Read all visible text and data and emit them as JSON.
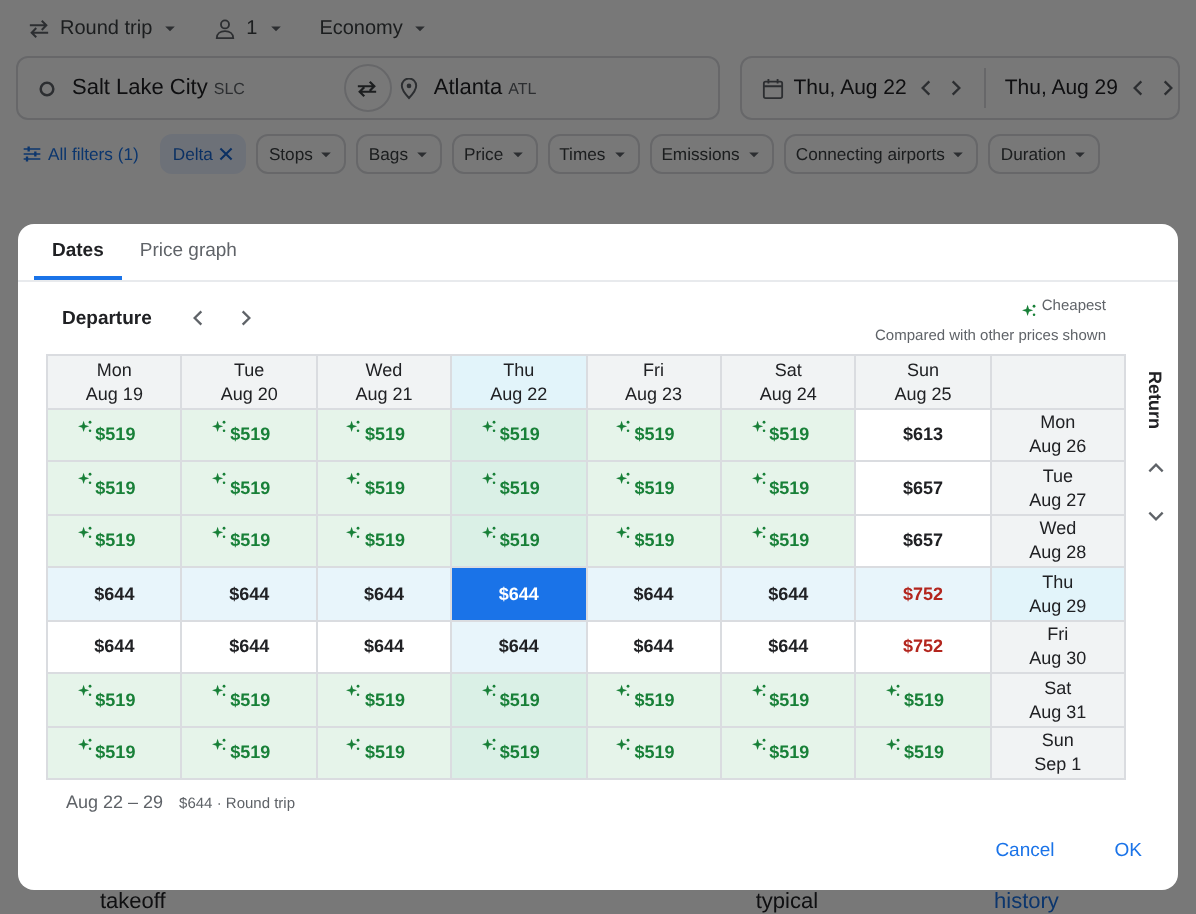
{
  "top_bar": {
    "trip_type": "Round trip",
    "passengers": "1",
    "cabin": "Economy"
  },
  "search": {
    "origin": {
      "city": "Salt Lake City",
      "code": "SLC"
    },
    "destination": {
      "city": "Atlanta",
      "code": "ATL"
    },
    "departure_date": "Thu, Aug 22",
    "return_date": "Thu, Aug 29"
  },
  "filters": [
    {
      "label": "All filters (1)",
      "kind": "all"
    },
    {
      "label": "Delta",
      "kind": "active"
    },
    {
      "label": "Stops",
      "kind": "dropdown"
    },
    {
      "label": "Bags",
      "kind": "dropdown"
    },
    {
      "label": "Price",
      "kind": "dropdown"
    },
    {
      "label": "Times",
      "kind": "dropdown"
    },
    {
      "label": "Emissions",
      "kind": "dropdown"
    },
    {
      "label": "Connecting airports",
      "kind": "dropdown"
    },
    {
      "label": "Duration",
      "kind": "dropdown"
    }
  ],
  "background_texts": [
    {
      "text": "takeoff",
      "kind": "text"
    },
    {
      "text": "typical",
      "kind": "text"
    },
    {
      "text": "history",
      "kind": "link"
    }
  ],
  "dialog": {
    "tabs": [
      {
        "label": "Dates",
        "selected": true
      },
      {
        "label": "Price graph",
        "selected": false
      }
    ],
    "departure_label": "Departure",
    "legend": "Cheapest",
    "legend_note": "Compared with other prices shown",
    "return_label": "Return",
    "columns": [
      {
        "day": "Mon",
        "date": "Aug 19",
        "selected": false
      },
      {
        "day": "Tue",
        "date": "Aug 20",
        "selected": false
      },
      {
        "day": "Wed",
        "date": "Aug 21",
        "selected": false
      },
      {
        "day": "Thu",
        "date": "Aug 22",
        "selected": true
      },
      {
        "day": "Fri",
        "date": "Aug 23",
        "selected": false
      },
      {
        "day": "Sat",
        "date": "Aug 24",
        "selected": false
      },
      {
        "day": "Sun",
        "date": "Aug 25",
        "selected": false
      }
    ],
    "rows": [
      {
        "day": "Mon",
        "date": "Aug 26",
        "selected": false,
        "cells": [
          {
            "price": "$519",
            "kind": "cheapest"
          },
          {
            "price": "$519",
            "kind": "cheapest"
          },
          {
            "price": "$519",
            "kind": "cheapest"
          },
          {
            "price": "$519",
            "kind": "cheapest"
          },
          {
            "price": "$519",
            "kind": "cheapest"
          },
          {
            "price": "$519",
            "kind": "cheapest"
          },
          {
            "price": "$613",
            "kind": "normal"
          }
        ]
      },
      {
        "day": "Tue",
        "date": "Aug 27",
        "selected": false,
        "cells": [
          {
            "price": "$519",
            "kind": "cheapest"
          },
          {
            "price": "$519",
            "kind": "cheapest"
          },
          {
            "price": "$519",
            "kind": "cheapest"
          },
          {
            "price": "$519",
            "kind": "cheapest"
          },
          {
            "price": "$519",
            "kind": "cheapest"
          },
          {
            "price": "$519",
            "kind": "cheapest"
          },
          {
            "price": "$657",
            "kind": "normal"
          }
        ]
      },
      {
        "day": "Wed",
        "date": "Aug 28",
        "selected": false,
        "cells": [
          {
            "price": "$519",
            "kind": "cheapest"
          },
          {
            "price": "$519",
            "kind": "cheapest"
          },
          {
            "price": "$519",
            "kind": "cheapest"
          },
          {
            "price": "$519",
            "kind": "cheapest"
          },
          {
            "price": "$519",
            "kind": "cheapest"
          },
          {
            "price": "$519",
            "kind": "cheapest"
          },
          {
            "price": "$657",
            "kind": "normal"
          }
        ]
      },
      {
        "day": "Thu",
        "date": "Aug 29",
        "selected": true,
        "cells": [
          {
            "price": "$644",
            "kind": "normal"
          },
          {
            "price": "$644",
            "kind": "normal"
          },
          {
            "price": "$644",
            "kind": "normal"
          },
          {
            "price": "$644",
            "kind": "normal"
          },
          {
            "price": "$644",
            "kind": "normal"
          },
          {
            "price": "$644",
            "kind": "normal"
          },
          {
            "price": "$752",
            "kind": "expensive"
          }
        ]
      },
      {
        "day": "Fri",
        "date": "Aug 30",
        "selected": false,
        "cells": [
          {
            "price": "$644",
            "kind": "normal"
          },
          {
            "price": "$644",
            "kind": "normal"
          },
          {
            "price": "$644",
            "kind": "normal"
          },
          {
            "price": "$644",
            "kind": "normal"
          },
          {
            "price": "$644",
            "kind": "normal"
          },
          {
            "price": "$644",
            "kind": "normal"
          },
          {
            "price": "$752",
            "kind": "expensive"
          }
        ]
      },
      {
        "day": "Sat",
        "date": "Aug 31",
        "selected": false,
        "cells": [
          {
            "price": "$519",
            "kind": "cheapest"
          },
          {
            "price": "$519",
            "kind": "cheapest"
          },
          {
            "price": "$519",
            "kind": "cheapest"
          },
          {
            "price": "$519",
            "kind": "cheapest"
          },
          {
            "price": "$519",
            "kind": "cheapest"
          },
          {
            "price": "$519",
            "kind": "cheapest"
          },
          {
            "price": "$519",
            "kind": "cheapest"
          }
        ]
      },
      {
        "day": "Sun",
        "date": "Sep 1",
        "selected": false,
        "cells": [
          {
            "price": "$519",
            "kind": "cheapest"
          },
          {
            "price": "$519",
            "kind": "cheapest"
          },
          {
            "price": "$519",
            "kind": "cheapest"
          },
          {
            "price": "$519",
            "kind": "cheapest"
          },
          {
            "price": "$519",
            "kind": "cheapest"
          },
          {
            "price": "$519",
            "kind": "cheapest"
          },
          {
            "price": "$519",
            "kind": "cheapest"
          }
        ]
      }
    ],
    "summary": {
      "dates": "Aug 22 – 29",
      "detail": "$644 · Round trip"
    },
    "buttons": [
      {
        "label": "Cancel"
      },
      {
        "label": "OK"
      }
    ]
  }
}
